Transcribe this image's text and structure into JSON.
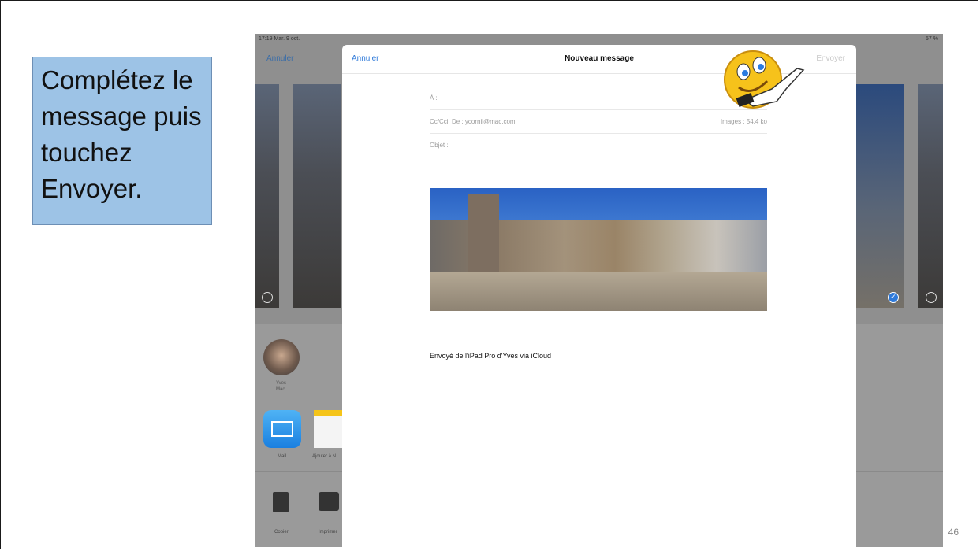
{
  "slide": {
    "instruction": "Complétez le\nmessage puis\ntouchez\nEnvoyer.",
    "page_number": "46"
  },
  "ipad": {
    "status_time": "17:19  Mar. 9 oct.",
    "status_battery": "57 %",
    "background_cancel": "Annuler",
    "share": {
      "contact_name": "Yves\nMac",
      "mail_label": "Mail",
      "add_label": "Ajouter à N",
      "copy_label": "Copier",
      "print_label": "Imprimer"
    }
  },
  "compose": {
    "cancel_label": "Annuler",
    "title": "Nouveau message",
    "send_label": "Envoyer",
    "to_label": "À :",
    "cc_label": "Cc/Cci, De : ycornil@mac.com",
    "images_size": "Images : 54,4 ko",
    "subject_label": "Objet :",
    "signature": "Envoyé de l'iPad Pro d'Yves via iCloud"
  },
  "colors": {
    "callout_bg": "#9dc3e6",
    "ios_blue": "#2f7ad9"
  },
  "icons": [
    "mail-icon",
    "copy-icon",
    "print-icon",
    "checkmark-icon",
    "smiley-pointing-icon"
  ]
}
